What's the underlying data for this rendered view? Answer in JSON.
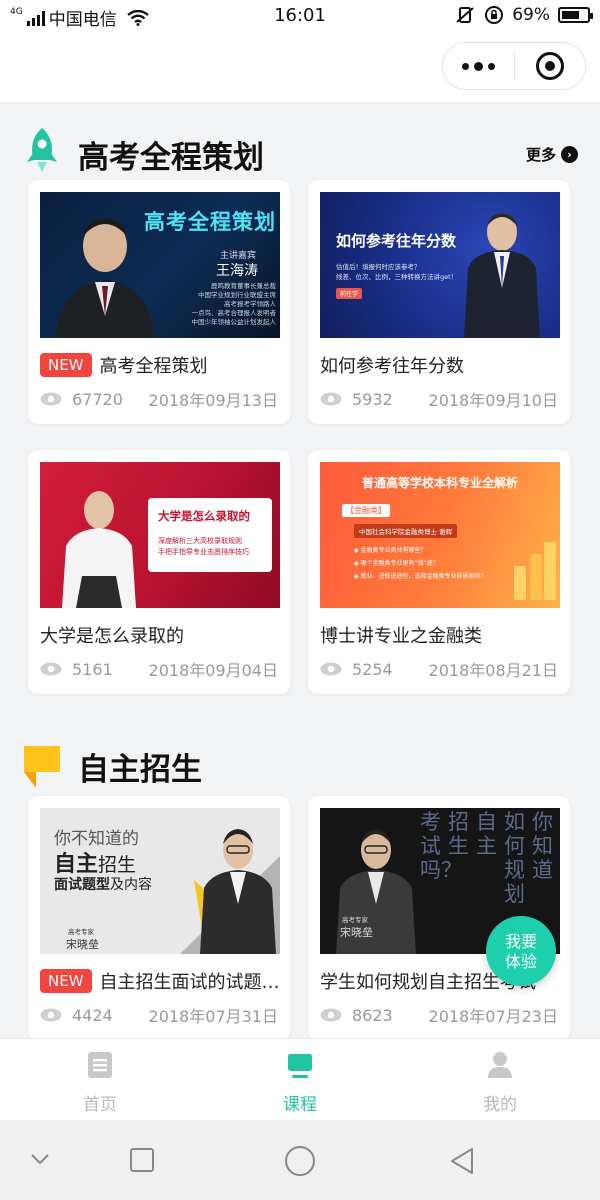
{
  "status_bar": {
    "network": "4G",
    "carrier": "中国电信",
    "time": "16:01",
    "battery": "69%",
    "battery_level": 0.69
  },
  "sections": [
    {
      "title": "高考全程策划",
      "more_label": "更多",
      "icon": "rocket-icon"
    },
    {
      "title": "自主招生",
      "icon": "flag-icon"
    }
  ],
  "cards": [
    {
      "title": "高考全程策划",
      "badge": "NEW",
      "views": "67720",
      "date": "2018年09月13日",
      "thumb": {
        "headline": "高考全程策划",
        "speaker_role": "主讲嘉宾",
        "speaker_name": "王海涛",
        "lines": [
          "鹿鸣教育董事长兼总裁",
          "中国学业规划行业联盟主席",
          "高考报考学领路人",
          "一点鸟、高考合理报人发明者",
          "中国少年领袖公益计划发起人"
        ]
      }
    },
    {
      "title": "如何参考往年分数",
      "views": "5932",
      "date": "2018年09月10日",
      "thumb": {
        "headline": "如何参考往年分数",
        "lines": [
          "估值后！填报何时应该参考？",
          "线差、位次、比例，三种转换方法讲get！"
        ],
        "tag": "前往学"
      }
    },
    {
      "title": "大学是怎么录取的",
      "views": "5161",
      "date": "2018年09月04日",
      "thumb": {
        "headline": "大学是怎么录取的",
        "lines": [
          "深度解析三大高校录取规则",
          "手把手指导专业志愿排序技巧"
        ]
      }
    },
    {
      "title": "博士讲专业之金融类",
      "views": "5254",
      "date": "2018年08月21日",
      "thumb": {
        "headline": "普通高等学校本科专业全解析",
        "tag": "【金融类】",
        "speaker": "中国社会科学院金融类博士 谢辉",
        "lines": [
          "◆ 金融类专业具体有哪些？",
          "◆ 哪个金融类专业更有“钱”途？",
          "◆ 就业、进修进途径、选择金融类专业前景如何？"
        ]
      }
    },
    {
      "title": "自主招生面试的试题题型及内容",
      "badge": "NEW",
      "views": "4424",
      "date": "2018年07月31日",
      "thumb": {
        "line1": "你不知道的",
        "line2_bold": "自主",
        "line2_rest": "招生",
        "line3_bold": "面试题型",
        "line3_rest": "及内容",
        "speaker_role": "高考专家",
        "speaker_name": "宋晓垒"
      }
    },
    {
      "title": "学生如何规划自主招生考试",
      "views": "8623",
      "date": "2018年07月23日",
      "thumb": {
        "col1": "你知道",
        "col2": "如何规划",
        "col3": "自主",
        "col4": "招生",
        "col5": "考试吗？",
        "speaker_role": "高考专家",
        "speaker_name": "宋晓垒"
      }
    }
  ],
  "fab": {
    "line1": "我要",
    "line2": "体验"
  },
  "tabs": [
    {
      "label": "首页",
      "active": false,
      "icon": "home-icon"
    },
    {
      "label": "课程",
      "active": true,
      "icon": "course-icon"
    },
    {
      "label": "我的",
      "active": false,
      "icon": "profile-icon"
    }
  ],
  "colors": {
    "accent": "#21c3a2",
    "badge": "#f2453d",
    "fab": "#1ecfae"
  }
}
